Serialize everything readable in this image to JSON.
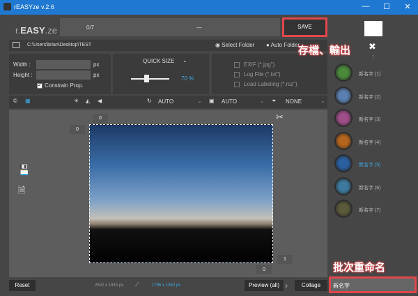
{
  "window": {
    "title": "rEASYze v.2.6",
    "minimize": "—",
    "maximize": "☐",
    "close": "✕"
  },
  "logo": {
    "r": "r.",
    "easy": "EASY",
    "ze": ".ze"
  },
  "topbar": {
    "progress": "0/7",
    "status": "—",
    "save_label": "SAVE"
  },
  "path": {
    "value": "C:\\Users\\brian\\Desktop\\TEST",
    "select_folder": "Select Folder",
    "auto_folder": "Auto Folder"
  },
  "size": {
    "width_label": "Width :",
    "height_label": "Height :",
    "unit": "px",
    "constrain": "Constrain Prop.",
    "constrain_checked": true
  },
  "quick_size": {
    "label": "QUICK SIZE",
    "value": "70 %",
    "slider_percent": 70
  },
  "options": [
    "EXIF (*.jpg\")",
    "Log File (*.txt\")",
    "Load Labeling (*.rsz\")"
  ],
  "toolbar": {
    "rotate": "AUTO",
    "print": "AUTO",
    "filter": "NONE"
  },
  "canvas": {
    "top_offset": "0",
    "left_offset": "0",
    "right_value": "1",
    "bottom_value": "0"
  },
  "bottom": {
    "reset": "Reset",
    "original_size": "2592 x 1944 px",
    "new_size": "1796 x 1360 px",
    "preview": "Preview (all)",
    "collage": "Collage"
  },
  "sidebar": {
    "count": "7",
    "items": [
      "新名字 (1)",
      "新名字 (2)",
      "新名字 (3)",
      "新名字 (4)",
      "新名字 (5)",
      "新名字 (6)",
      "新名字 (7)"
    ],
    "active_index": 4,
    "rename_value": "新名字"
  },
  "annotations": {
    "save": "存檔、輸出",
    "rename": "批次重命名"
  },
  "colors": {
    "accent": "#3ea8e5",
    "highlight": "#e0474c",
    "titlebar": "#1f78d2"
  }
}
